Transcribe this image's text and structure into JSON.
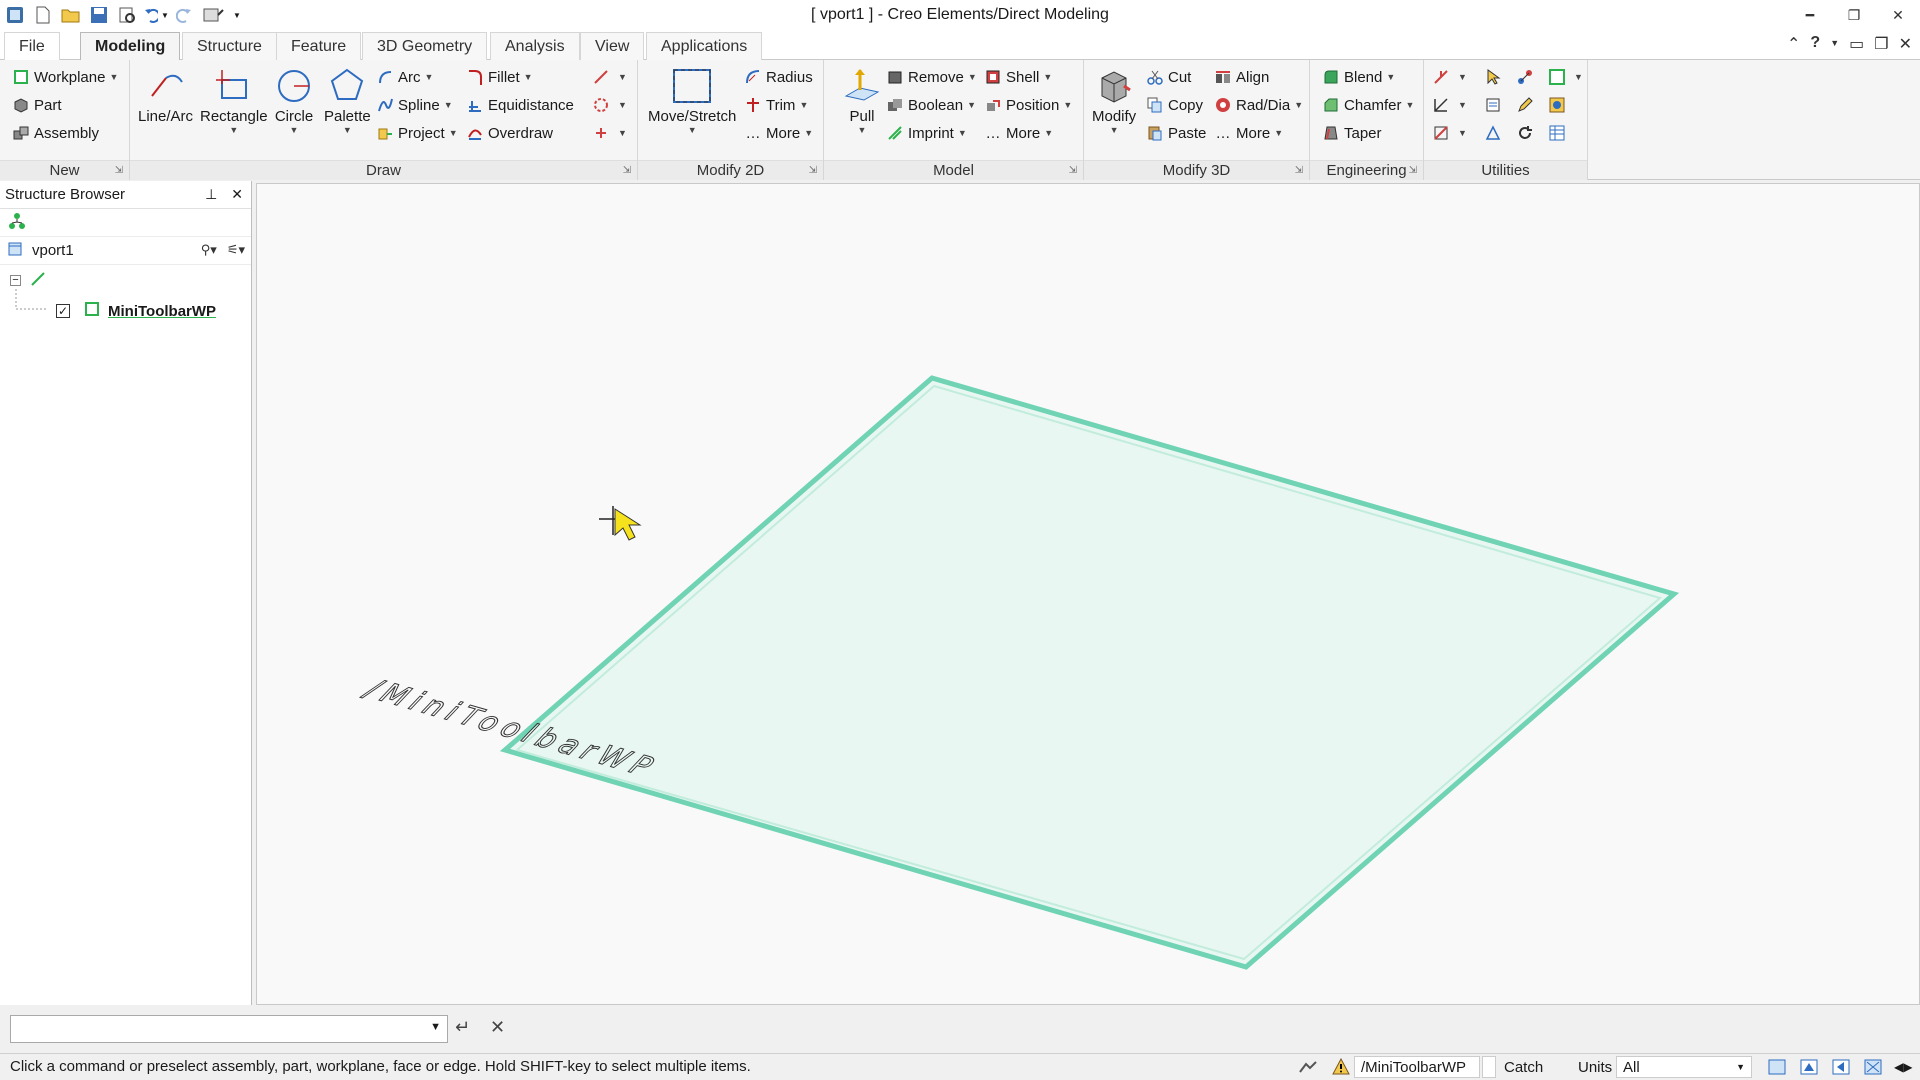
{
  "window": {
    "title": "[ vport1 ] - Creo Elements/Direct Modeling"
  },
  "tabs": [
    "File",
    "Modeling",
    "Structure",
    "Feature",
    "3D Geometry",
    "Analysis",
    "View",
    "Applications"
  ],
  "active_tab": "Modeling",
  "ribbon": {
    "new_group": {
      "label": "New",
      "workplane": "Workplane",
      "part": "Part",
      "assembly": "Assembly"
    },
    "draw_group": {
      "label": "Draw",
      "line_arc": "Line/Arc",
      "rectangle": "Rectangle",
      "circle": "Circle",
      "palette": "Palette",
      "arc": "Arc",
      "spline": "Spline",
      "project": "Project",
      "fillet": "Fillet",
      "equidistance": "Equidistance",
      "overdraw": "Overdraw"
    },
    "modify2d_group": {
      "label": "Modify 2D",
      "move_stretch": "Move/Stretch",
      "radius": "Radius",
      "trim": "Trim",
      "more": "More"
    },
    "model_group": {
      "label": "Model",
      "pull": "Pull",
      "remove": "Remove",
      "boolean": "Boolean",
      "imprint": "Imprint",
      "shell": "Shell",
      "position": "Position",
      "more": "More"
    },
    "modify3d_group": {
      "label": "Modify 3D",
      "modify": "Modify",
      "cut": "Cut",
      "copy": "Copy",
      "paste": "Paste",
      "align": "Align",
      "rad_dia": "Rad/Dia",
      "more": "More"
    },
    "engineering_group": {
      "label": "Engineering",
      "blend": "Blend",
      "chamfer": "Chamfer",
      "taper": "Taper"
    },
    "utilities_group": {
      "label": "Utilities"
    }
  },
  "structure_browser": {
    "title": "Structure Browser",
    "root": "vport1",
    "items": [
      {
        "label": "MiniToolbarWP",
        "checked": true
      }
    ]
  },
  "viewport": {
    "workplane_label": "/MiniToolbarWP",
    "workplane_color": "#6fd3b4"
  },
  "command_line": {
    "value": ""
  },
  "statusbar": {
    "message": "Click a command or preselect assembly, part, workplane, face or edge. Hold SHIFT-key to select multiple items.",
    "active_wp": "/MiniToolbarWP",
    "catch": "Catch",
    "units": "Units",
    "filter": "All"
  }
}
